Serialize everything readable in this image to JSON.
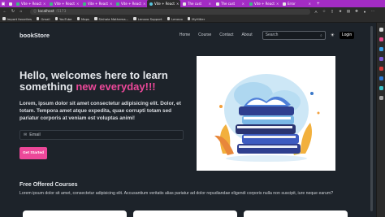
{
  "browser": {
    "tabs": [
      {
        "label": "",
        "icon": "gem-icon"
      },
      {
        "label": "Vite + React",
        "icon": "vite-icon"
      },
      {
        "label": "Vite + React",
        "icon": "vite-icon"
      },
      {
        "label": "Vite + React",
        "icon": "vite-icon"
      },
      {
        "label": "Vite + React",
        "icon": "vite-icon"
      },
      {
        "label": "Vite + React",
        "icon": "react-icon",
        "active": true
      },
      {
        "label": "The cust",
        "icon": "page-icon"
      },
      {
        "label": "The cust",
        "icon": "page-icon"
      },
      {
        "label": "Vite + React",
        "icon": "vite-icon"
      },
      {
        "label": "Error",
        "icon": "page-icon"
      }
    ],
    "url_host": "localhost",
    "url_port": ":5173",
    "bookmarks": [
      {
        "label": "Import favorites"
      },
      {
        "label": "Gmail"
      },
      {
        "label": "YouTube"
      },
      {
        "label": "Maps"
      },
      {
        "label": "Sinhala Mathema..."
      },
      {
        "label": "Lenovo Support"
      },
      {
        "label": "Lenovo"
      },
      {
        "label": "MyHitler"
      }
    ]
  },
  "nav": {
    "brand": "bookStore",
    "links": [
      "Home",
      "Course",
      "Contact",
      "About"
    ],
    "search_placeholder": "Search",
    "login_label": "Login"
  },
  "hero": {
    "title_line1": "Hello, welcomes here to learn",
    "title_line2_prefix": "something ",
    "title_line2_accent": "new everyday!!!",
    "paragraph": "Lorem, ipsum dolor sit amet consectetur adipisicing elit. Dolor, et totam. Tempora amet atque expedita, quae corrupti totam sed pariatur corporis at veniam est voluptas animi!",
    "email_placeholder": "Email",
    "cta_label": "Get Started"
  },
  "courses": {
    "title": "Free Offered Courses",
    "text": "Lorem ipsum dolor sit amet, consectetur adipisicing elit. Accusantium veritatis alias pariatur ad dolor repudiandae eligendi corporis nulla non suscipit, iure neque earum?"
  },
  "colors": {
    "tabbar": "#a32cc4",
    "page_bg": "#1d232a",
    "accent": "#ec4899"
  }
}
